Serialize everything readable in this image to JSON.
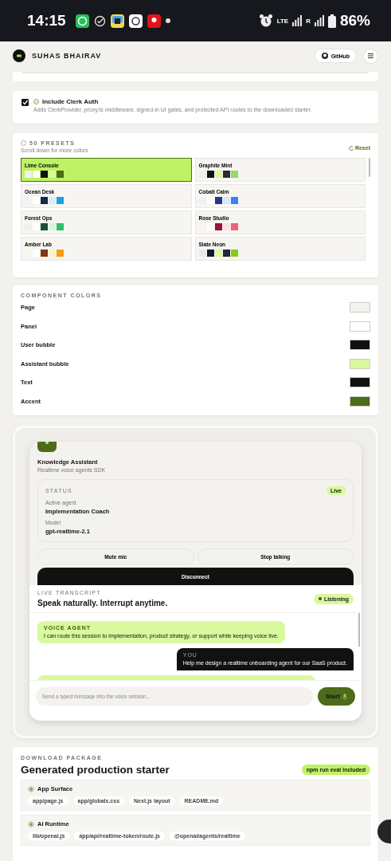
{
  "status_bar": {
    "time": "14:15",
    "network": "LTE",
    "roaming": "R",
    "battery": "86%"
  },
  "header": {
    "brand": "SUHAS BHAIRAV",
    "github": "GitHub"
  },
  "auth": {
    "checked": true,
    "title": "Include Clerk Auth",
    "description": "Adds ClerkProvider, proxy.ts middleware, signed-in UI gates, and protected API routes to the downloaded starter."
  },
  "presets": {
    "title": "50 PRESETS",
    "subtitle": "Scroll down for more colors",
    "reset": "Reset",
    "items": [
      {
        "name": "Lime Console",
        "selected": true,
        "swatches": [
          {
            "color": "#f2f2ee"
          },
          {
            "color": "#ffffff"
          },
          {
            "color": "#111111"
          },
          {
            "color": "#d9f99d"
          },
          {
            "color": "#4d6b1a"
          }
        ]
      },
      {
        "name": "Graphite Mint",
        "selected": false,
        "swatches": [
          {
            "color": "#eceef0"
          },
          {
            "color": "#111111"
          },
          {
            "color": "#d9f99d"
          },
          {
            "color": "#2a2d2e"
          },
          {
            "color": "#8fdc6a"
          }
        ]
      },
      {
        "name": "Ocean Desk",
        "selected": false,
        "swatches": [
          {
            "color": "#eef4f8"
          },
          {
            "color": "#ffffff"
          },
          {
            "color": "#0f2d48"
          },
          {
            "color": "#d6ecfb"
          },
          {
            "color": "#1ea0dc"
          }
        ]
      },
      {
        "name": "Cobalt Calm",
        "selected": false,
        "swatches": [
          {
            "color": "#edf0f7"
          },
          {
            "color": "#ffffff"
          },
          {
            "color": "#1e3a8a"
          },
          {
            "color": "#dbe6fb"
          },
          {
            "color": "#3b82f6"
          }
        ]
      },
      {
        "name": "Forest Ops",
        "selected": false,
        "swatches": [
          {
            "color": "#eef1ee"
          },
          {
            "color": "#ffffff"
          },
          {
            "color": "#1f4d33"
          },
          {
            "color": "#d7f5e1"
          },
          {
            "color": "#2fbf6a"
          }
        ]
      },
      {
        "name": "Rose Studio",
        "selected": false,
        "swatches": [
          {
            "color": "#fbf1f3"
          },
          {
            "color": "#ffffff"
          },
          {
            "color": "#9f1239"
          },
          {
            "color": "#fde0e6"
          },
          {
            "color": "#f0607a"
          }
        ]
      },
      {
        "name": "Amber Lab",
        "selected": false,
        "swatches": [
          {
            "color": "#fbf7ea"
          },
          {
            "color": "#ffffff"
          },
          {
            "color": "#7c3a12"
          },
          {
            "color": "#fdefc9"
          },
          {
            "color": "#f59e0b"
          }
        ]
      },
      {
        "name": "Slate Neon",
        "selected": false,
        "swatches": [
          {
            "color": "#e5e8ee"
          },
          {
            "color": "#111827"
          },
          {
            "color": "#d9f99d"
          },
          {
            "color": "#1f2937"
          },
          {
            "color": "#84cc16"
          }
        ]
      }
    ]
  },
  "component_colors": {
    "title": "COMPONENT COLORS",
    "items": [
      {
        "label": "Page",
        "color": "#f2f2ee"
      },
      {
        "label": "Panel",
        "color": "#ffffff"
      },
      {
        "label": "User bubble",
        "color": "#111111"
      },
      {
        "label": "Assistant bubble",
        "color": "#d9f99d"
      },
      {
        "label": "Text",
        "color": "#111111"
      },
      {
        "label": "Accent",
        "color": "#4d6b1a"
      }
    ]
  },
  "voice_demo": {
    "title": "Knowledge Assistant",
    "subtitle": "Realtime voice agents SDK",
    "status": {
      "label": "STATUS",
      "badge": "Live",
      "agent_label": "Active agent",
      "agent": "Implementation Coach",
      "model_label": "Model",
      "model": "gpt-realtime-2.1"
    },
    "buttons": [
      "Mute mic",
      "Stop talking"
    ],
    "disconnect": "Disconnect",
    "transcript": {
      "label": "LIVE TRANSCRIPT",
      "title": "Speak naturally. Interrupt anytime.",
      "badge": "Listening",
      "messages": [
        {
          "kind": "agent",
          "sender": "VOICE AGENT",
          "text": "I can route this session to implementation, product strategy, or support while keeping voice live."
        },
        {
          "kind": "user",
          "sender": "YOU",
          "text": "Help me design a realtime onboarding agent for our SaaS product."
        },
        {
          "kind": "agent"
        }
      ]
    },
    "input": {
      "placeholder": "Send a typed message into the voice session..."
    },
    "start": "Start"
  },
  "download": {
    "label": "DOWNLOAD PACKAGE",
    "title": "Generated production starter",
    "badge": "npm run eval included",
    "groups": [
      {
        "title": "App Surface",
        "files": [
          "app/page.js",
          "app/globals.css",
          "Next.js layout",
          "README.md"
        ]
      },
      {
        "title": "AI Runtime",
        "files": [
          "lib/openai.js",
          "app/api/realtime-token/route.js",
          "@openai/agents/realtime"
        ]
      }
    ]
  }
}
